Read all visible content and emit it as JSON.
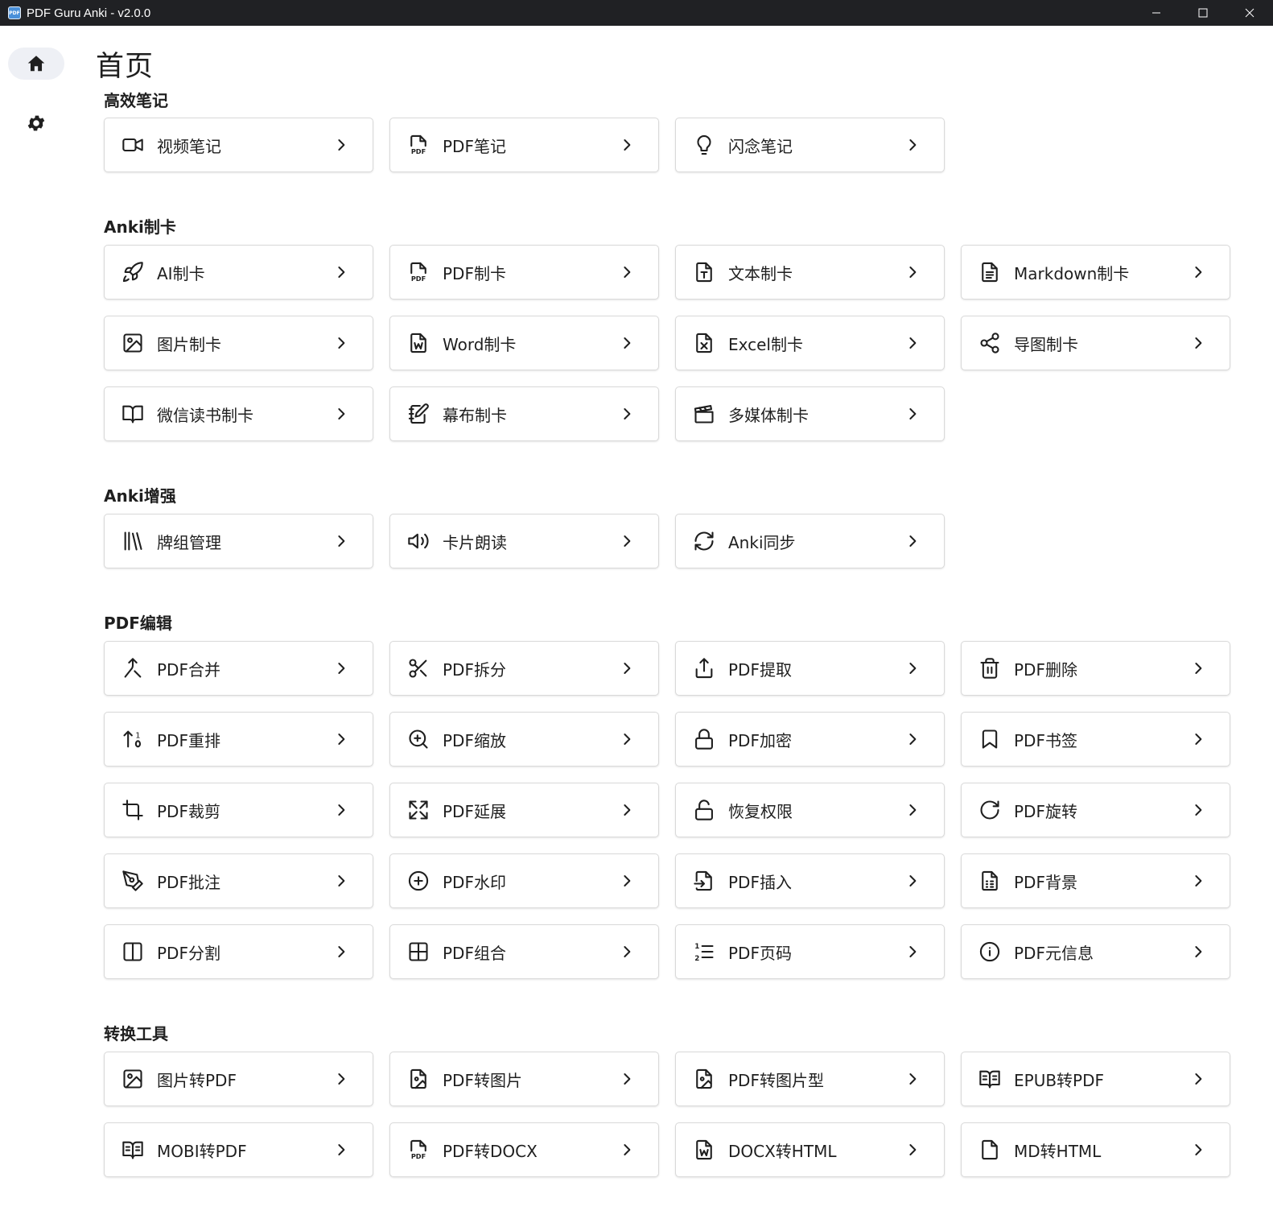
{
  "window": {
    "title": "PDF Guru Anki - v2.0.0",
    "app_icon_text": "PDF"
  },
  "sidebar": {
    "items": [
      {
        "name": "home",
        "icon": "home-icon",
        "active": true
      },
      {
        "name": "settings",
        "icon": "gear-icon",
        "active": false
      }
    ]
  },
  "page": {
    "title": "首页"
  },
  "sections": {
    "notes": {
      "title": "高效笔记",
      "items": [
        {
          "label": "视频笔记",
          "icon": "video-icon"
        },
        {
          "label": "PDF笔记",
          "icon": "pdf-file-icon"
        },
        {
          "label": "闪念笔记",
          "icon": "lightbulb-icon"
        }
      ]
    },
    "cards": {
      "title": "Anki制卡",
      "items": [
        {
          "label": "AI制卡",
          "icon": "rocket-icon"
        },
        {
          "label": "PDF制卡",
          "icon": "pdf-file-icon"
        },
        {
          "label": "文本制卡",
          "icon": "text-file-icon"
        },
        {
          "label": "Markdown制卡",
          "icon": "document-icon"
        },
        {
          "label": "图片制卡",
          "icon": "image-icon"
        },
        {
          "label": "Word制卡",
          "icon": "word-file-icon"
        },
        {
          "label": "Excel制卡",
          "icon": "excel-file-icon"
        },
        {
          "label": "导图制卡",
          "icon": "share-nodes-icon"
        },
        {
          "label": "微信读书制卡",
          "icon": "open-book-icon"
        },
        {
          "label": "幕布制卡",
          "icon": "notebook-edit-icon"
        },
        {
          "label": "多媒体制卡",
          "icon": "clapperboard-icon"
        }
      ]
    },
    "enhance": {
      "title": "Anki增强",
      "items": [
        {
          "label": "牌组管理",
          "icon": "library-icon"
        },
        {
          "label": "卡片朗读",
          "icon": "speaker-icon"
        },
        {
          "label": "Anki同步",
          "icon": "refresh-icon"
        }
      ]
    },
    "pdf_edit": {
      "title": "PDF编辑",
      "items": [
        {
          "label": "PDF合并",
          "icon": "merge-icon"
        },
        {
          "label": "PDF拆分",
          "icon": "scissors-icon"
        },
        {
          "label": "PDF提取",
          "icon": "upload-icon"
        },
        {
          "label": "PDF删除",
          "icon": "trash-icon"
        },
        {
          "label": "PDF重排",
          "icon": "sort-icon"
        },
        {
          "label": "PDF缩放",
          "icon": "zoom-in-icon"
        },
        {
          "label": "PDF加密",
          "icon": "lock-icon"
        },
        {
          "label": "PDF书签",
          "icon": "bookmark-icon"
        },
        {
          "label": "PDF裁剪",
          "icon": "crop-icon"
        },
        {
          "label": "PDF延展",
          "icon": "expand-icon"
        },
        {
          "label": "恢复权限",
          "icon": "unlock-icon"
        },
        {
          "label": "PDF旋转",
          "icon": "rotate-icon"
        },
        {
          "label": "PDF批注",
          "icon": "pen-tool-icon"
        },
        {
          "label": "PDF水印",
          "icon": "plus-circle-icon"
        },
        {
          "label": "PDF插入",
          "icon": "file-import-icon"
        },
        {
          "label": "PDF背景",
          "icon": "file-grid-icon"
        },
        {
          "label": "PDF分割",
          "icon": "columns-icon"
        },
        {
          "label": "PDF组合",
          "icon": "grid-icon"
        },
        {
          "label": "PDF页码",
          "icon": "numbered-list-icon"
        },
        {
          "label": "PDF元信息",
          "icon": "info-icon"
        }
      ]
    },
    "convert": {
      "title": "转换工具",
      "items": [
        {
          "label": "图片转PDF",
          "icon": "image-icon"
        },
        {
          "label": "PDF转图片",
          "icon": "file-image-icon"
        },
        {
          "label": "PDF转图片型",
          "icon": "file-image-icon"
        },
        {
          "label": "EPUB转PDF",
          "icon": "open-book-text-icon"
        },
        {
          "label": "MOBI转PDF",
          "icon": "open-book-text-icon"
        },
        {
          "label": "PDF转DOCX",
          "icon": "pdf-file-icon"
        },
        {
          "label": "DOCX转HTML",
          "icon": "word-file-icon"
        },
        {
          "label": "MD转HTML",
          "icon": "file-icon"
        }
      ]
    }
  }
}
